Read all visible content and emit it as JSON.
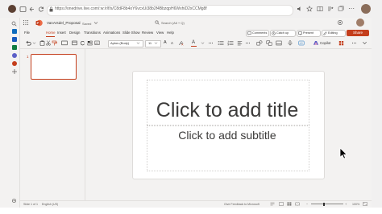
{
  "browser": {
    "url": "https://onedrive.live.com/:w:/r/f/s/C8dF8b4oY6vcxUi38b2f4BbzqpH6WxhiD2xCCMg8f",
    "menu_glyph": "⋯"
  },
  "app": {
    "file_name": "VanArsdel_Proposal",
    "save_status": "Saved",
    "search_placeholder": "Search (Alt + Q)"
  },
  "ribbon": {
    "tabs": [
      {
        "label": "File"
      },
      {
        "label": "Home"
      },
      {
        "label": "Insert"
      },
      {
        "label": "Design"
      },
      {
        "label": "Transitions"
      },
      {
        "label": "Animations"
      },
      {
        "label": "Slide Show"
      },
      {
        "label": "Review"
      },
      {
        "label": "View"
      },
      {
        "label": "Help"
      }
    ],
    "active_tab": "Home",
    "comments_label": "Comments",
    "catchup_label": "Catch up",
    "present_label": "Present",
    "editing_label": "Editing",
    "share_label": "Share"
  },
  "toolbar": {
    "font_name": "Aptos (Body)",
    "font_size": "11",
    "bold": "B",
    "italic": "I",
    "underline": "U",
    "grow_font": "A",
    "shrink_font": "A",
    "copilot_label": "Copilot"
  },
  "thumbnails": [
    {
      "number": "1"
    }
  ],
  "slide": {
    "title_placeholder": "Click to add title",
    "subtitle_placeholder": "Click to add subtitle"
  },
  "status_bar": {
    "slide_info": "Slide 1 of 1",
    "language": "English (US)",
    "feedback": "Give Feedback to Microsoft",
    "zoom": "100%"
  },
  "colors": {
    "accent": "#c43e1c",
    "canvas": "#f3f2f1",
    "outlook_blue": "#0f6cbd",
    "teams_purple": "#5b5fc7",
    "excel_green": "#107c41",
    "word_blue": "#185abd"
  }
}
